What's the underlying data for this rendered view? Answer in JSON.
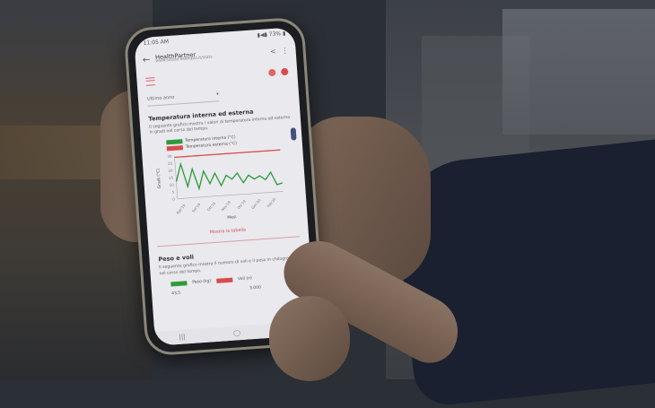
{
  "status_bar": {
    "time": "11:05 AM",
    "indicators": "▮◀▮ 73% ▮"
  },
  "app_bar": {
    "title": "HealthPartner",
    "subtitle": "www.salute-esempio.it/stats"
  },
  "dropdown": {
    "value": "Ultimo anno",
    "caret": "▾"
  },
  "temperature_section": {
    "title": "Temperatura interna ed esterna",
    "description": "Il seguente grafico mostra i valori di temperatura interna ed esterna in gradi nel corso del tempo.",
    "legend": [
      {
        "label": "Temperatura interna (°C)",
        "color": "#2e9a3c"
      },
      {
        "label": "Temperatura esterna (°C)",
        "color": "#d84c4c"
      }
    ],
    "link": "Mostra la tabella"
  },
  "weight_section": {
    "title": "Peso e voli",
    "description": "Il seguente grafico mostra il numero di voli e il peso in chilogrammi nel corso del tempo.",
    "legend": [
      {
        "label": "Peso (kg)",
        "color": "#2e9a3c"
      },
      {
        "label": "Voli (n)",
        "color": "#d84c4c"
      }
    ],
    "axis_left": "43,5",
    "axis_right": "3.000"
  },
  "nav": {
    "recent": "|||",
    "home": "◯",
    "back": "‹"
  },
  "colors": {
    "accent": "#d84c4c",
    "series_green": "#2e9a3c"
  },
  "chart_data": {
    "type": "line",
    "title": "",
    "xlabel": "Mesi",
    "ylabel": "Gradi (°C)",
    "ylim": [
      0,
      30
    ],
    "y_ticks": [
      "30",
      "25",
      "20",
      "15",
      "10",
      "5",
      "0"
    ],
    "x_ticks": [
      "Ago'19",
      "Set'19",
      "Ott'19",
      "Nov'19",
      "Dic'19",
      "Gen'20",
      "Feb'20"
    ],
    "series": [
      {
        "name": "Temperatura interna (°C)",
        "color": "#2e9a3c",
        "values": [
          12,
          24,
          8,
          20,
          6,
          18,
          9,
          16,
          7,
          14,
          11,
          15,
          8,
          13,
          10,
          12,
          9,
          14,
          5,
          6
        ]
      },
      {
        "name": "Temperatura esterna (°C)",
        "color": "#d84c4c",
        "values": [
          29,
          29,
          29,
          29,
          29,
          29,
          29,
          29,
          29,
          29,
          29,
          29,
          29,
          29,
          29,
          29,
          29,
          29,
          29,
          29
        ]
      }
    ]
  }
}
